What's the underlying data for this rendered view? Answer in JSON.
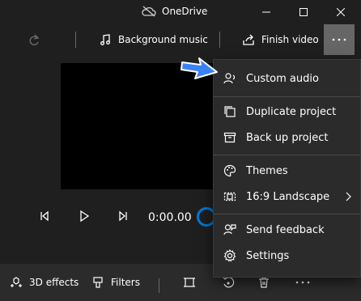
{
  "window": {
    "title": "OneDrive"
  },
  "toolbar": {
    "background_music_label": "Background music",
    "finish_video_label": "Finish video"
  },
  "playback": {
    "time": "0:00.00"
  },
  "bottombar": {
    "effects_label": "3D effects",
    "filters_label": "Filters"
  },
  "menu": {
    "items": [
      {
        "label": "Custom audio",
        "icon": "custom-audio-icon"
      },
      {
        "label": "Duplicate project",
        "icon": "duplicate-icon"
      },
      {
        "label": "Back up project",
        "icon": "archive-icon"
      },
      {
        "label": "Themes",
        "icon": "palette-icon"
      },
      {
        "label": "16:9 Landscape",
        "icon": "aspect-ratio-icon"
      },
      {
        "label": "Send feedback",
        "icon": "feedback-icon"
      },
      {
        "label": "Settings",
        "icon": "gear-icon"
      }
    ]
  },
  "colors": {
    "accent": "#0078d4",
    "annotation_arrow": "#3b82f6",
    "background": "#1f1f1f",
    "menu_background": "#2b2b2b"
  }
}
